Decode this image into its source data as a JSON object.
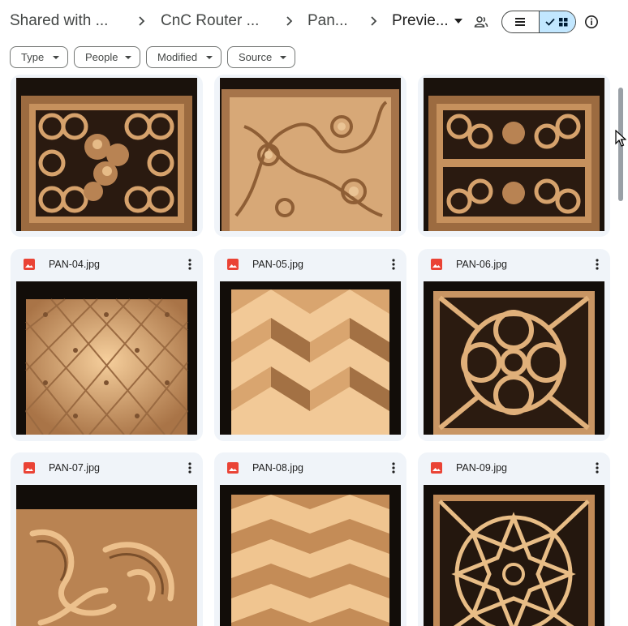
{
  "breadcrumb": {
    "items": [
      "Shared with ...",
      "CnC Router ...",
      "Pan...",
      "Previe..."
    ]
  },
  "view_toggle": {
    "list_icon": "list-icon",
    "grid_icon": "grid-icon",
    "selected": "grid"
  },
  "filters": [
    {
      "label": "Type"
    },
    {
      "label": "People"
    },
    {
      "label": "Modified"
    },
    {
      "label": "Source"
    }
  ],
  "files": [
    {
      "name": "",
      "thumbnail": "celtic-knot-panel-with-flowers"
    },
    {
      "name": "",
      "thumbnail": "floral-scroll-panel"
    },
    {
      "name": "",
      "thumbnail": "double-celtic-knot-panel"
    },
    {
      "name": "PAN-04.jpg",
      "thumbnail": "tufted-diamond-panel"
    },
    {
      "name": "PAN-05.jpg",
      "thumbnail": "zigzag-prism-panel"
    },
    {
      "name": "PAN-06.jpg",
      "thumbnail": "gothic-tracery-panel"
    },
    {
      "name": "PAN-07.jpg",
      "thumbnail": "acanthus-leaf-panel"
    },
    {
      "name": "PAN-08.jpg",
      "thumbnail": "chevron-wave-panel"
    },
    {
      "name": "PAN-09.jpg",
      "thumbnail": "islamic-star-lattice-panel"
    }
  ],
  "colors": {
    "card_bg": "#f0f4f9",
    "toggle_active": "#c2e7ff",
    "image_icon": "#ea4335",
    "wood_light": "#e8b98a",
    "wood_dark": "#8a5a33"
  }
}
